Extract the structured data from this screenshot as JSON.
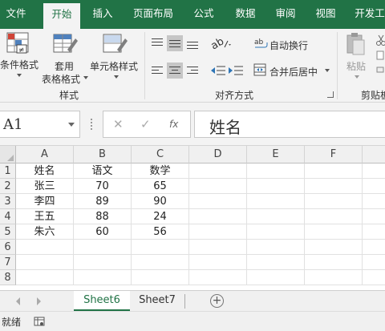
{
  "tabs": [
    {
      "label": "文件",
      "active": false
    },
    {
      "label": "开始",
      "active": true
    },
    {
      "label": "插入",
      "active": false
    },
    {
      "label": "页面布局",
      "active": false
    },
    {
      "label": "公式",
      "active": false
    },
    {
      "label": "数据",
      "active": false
    },
    {
      "label": "审阅",
      "active": false
    },
    {
      "label": "视图",
      "active": false
    },
    {
      "label": "开发工",
      "active": false
    }
  ],
  "ribbon": {
    "styles": {
      "conditional_format": "条件格式",
      "format_as_table_1": "套用",
      "format_as_table_2": "表格格式",
      "cell_styles": "单元格样式",
      "group_label": "样式"
    },
    "alignment": {
      "wrap_text": "自动换行",
      "merge_center": "合并后居中",
      "group_label": "对齐方式"
    },
    "clipboard": {
      "paste": "粘贴",
      "group_label": "剪贴板"
    }
  },
  "formula_bar": {
    "name_box": "A1",
    "content": "姓名",
    "fx_label": "fx"
  },
  "columns": [
    "A",
    "B",
    "C",
    "D",
    "E",
    "F"
  ],
  "rows": [
    "1",
    "2",
    "3",
    "4",
    "5",
    "6",
    "7",
    "8"
  ],
  "table": [
    [
      "姓名",
      "语文",
      "数学"
    ],
    [
      "张三",
      "70",
      "65"
    ],
    [
      "李四",
      "89",
      "90"
    ],
    [
      "王五",
      "88",
      "24"
    ],
    [
      "朱六",
      "60",
      "56"
    ]
  ],
  "sheets": [
    {
      "label": "Sheet6",
      "active": true
    },
    {
      "label": "Sheet7",
      "active": false
    }
  ],
  "status": {
    "ready": "就绪"
  },
  "colors": {
    "accent": "#217346"
  }
}
